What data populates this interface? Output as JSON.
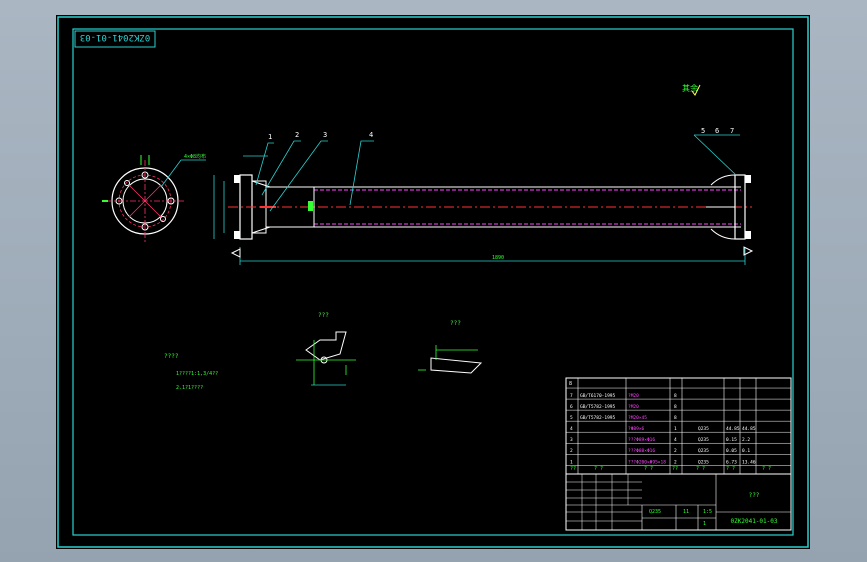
{
  "drawing": {
    "stamp_code": "0ZK2041-01-03",
    "top_right_mark": "其余",
    "callouts": [
      "1",
      "2",
      "3",
      "4",
      "5",
      "6",
      "7"
    ],
    "flange_note": "4×Φ8均布",
    "dim_overall_length": "1890",
    "detail_label_1": "???",
    "detail_label_2": "???",
    "notes": {
      "title": "????",
      "line1": "1????1:1,3/4??",
      "line2": "2.1?1????"
    }
  },
  "bom": {
    "top_index": "8",
    "rows": [
      {
        "no": "7",
        "code": "GB/T6170-1995",
        "name": "?M20",
        "qty": "8",
        "mat": "",
        "w1": "",
        "w2": ""
      },
      {
        "no": "6",
        "code": "GB/T5782-1995",
        "name": "?M20",
        "qty": "8",
        "mat": "",
        "w1": "",
        "w2": ""
      },
      {
        "no": "5",
        "code": "GB/T5782-1995",
        "name": "?M20×45",
        "qty": "8",
        "mat": "",
        "w1": "",
        "w2": ""
      },
      {
        "no": "4",
        "code": "",
        "name": "?Φ89×6",
        "qty": "1",
        "mat": "Q235",
        "w1": "44.85",
        "w2": "44.85"
      },
      {
        "no": "3",
        "code": "",
        "name": "???Φ89×Φ16",
        "qty": "4",
        "mat": "Q235",
        "w1": "0.15",
        "w2": "2.2"
      },
      {
        "no": "2",
        "code": "",
        "name": "???Φ88×Φ16",
        "qty": "2",
        "mat": "Q235",
        "w1": "0.05",
        "w2": "0.1"
      },
      {
        "no": "1",
        "code": "",
        "name": "???Φ200×Φ95×18",
        "qty": "2",
        "mat": "Q235",
        "w1": "6.73",
        "w2": "13.46"
      }
    ],
    "header": {
      "c1": "??",
      "c2": "? ?",
      "c3": "? ?",
      "c4": "??",
      "c5": "? ?",
      "c6": "? ?",
      "c7": "? ?"
    }
  },
  "title_block": {
    "title": "???",
    "code": "0ZK2041-01-03",
    "scale": "1:5",
    "weight": "11",
    "sheets": "1",
    "material": "Q235"
  }
}
